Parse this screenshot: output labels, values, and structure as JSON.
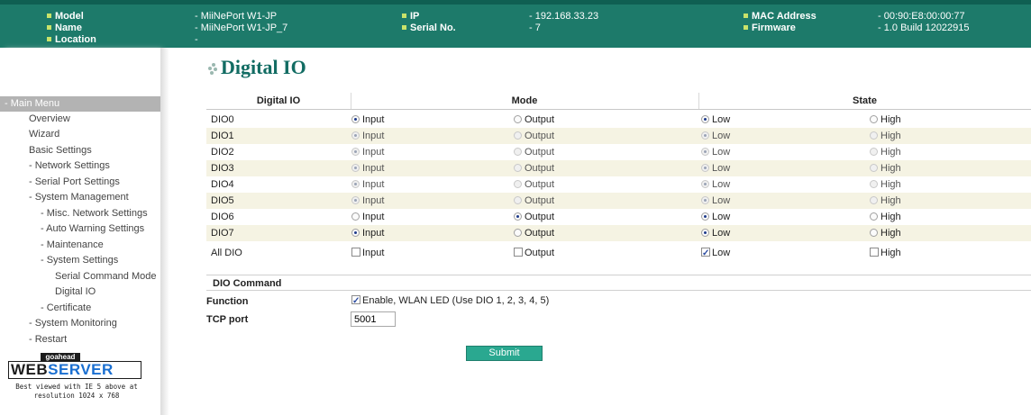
{
  "header": {
    "model_label": "Model",
    "model_value": "- MiiNePort W1-JP",
    "name_label": "Name",
    "name_value": "- MiiNePort W1-JP_7",
    "location_label": "Location",
    "location_value": "-",
    "ip_label": "IP",
    "ip_value": "- 192.168.33.23",
    "serial_label": "Serial No.",
    "serial_value": "- 7",
    "mac_label": "MAC Address",
    "mac_value": "- 00:90:E8:00:00:77",
    "firmware_label": "Firmware",
    "firmware_value": "- 1.0 Build 12022915"
  },
  "sidebar": {
    "menu_head": "- Main Menu",
    "items": [
      "Overview",
      "Wizard",
      "Basic Settings",
      "- Network Settings",
      "- Serial Port Settings",
      "- System Management",
      "- Misc. Network Settings",
      "- Auto Warning Settings",
      "- Maintenance",
      "- System Settings",
      "Serial Command Mode",
      "Digital IO",
      "- Certificate",
      "- System Monitoring",
      "- Restart"
    ],
    "logo_top": "goahead",
    "logo_web": "WEB",
    "logo_server": "SERVER",
    "logo_note_1": "Best viewed with IE 5 above at",
    "logo_note_2": "resolution 1024 x 768"
  },
  "page": {
    "title": "Digital IO",
    "col_dio": "Digital IO",
    "col_mode": "Mode",
    "col_state": "State",
    "input_label": "Input",
    "output_label": "Output",
    "low_label": "Low",
    "high_label": "High"
  },
  "rows": [
    {
      "name": "DIO0",
      "mode": "input",
      "state": "low",
      "enabled": true
    },
    {
      "name": "DIO1",
      "mode": "input",
      "state": "low",
      "enabled": false
    },
    {
      "name": "DIO2",
      "mode": "input",
      "state": "low",
      "enabled": false
    },
    {
      "name": "DIO3",
      "mode": "input",
      "state": "low",
      "enabled": false
    },
    {
      "name": "DIO4",
      "mode": "input",
      "state": "low",
      "enabled": false
    },
    {
      "name": "DIO5",
      "mode": "input",
      "state": "low",
      "enabled": false
    },
    {
      "name": "DIO6",
      "mode": "output",
      "state": "low",
      "enabled": true
    },
    {
      "name": "DIO7",
      "mode": "input",
      "state": "low",
      "enabled": true
    }
  ],
  "all_dio": {
    "name": "All DIO",
    "input_checked": false,
    "output_checked": false,
    "low_checked": true,
    "high_checked": false
  },
  "command": {
    "heading": "DIO Command",
    "function_label": "Function",
    "function_text": "Enable, WLAN LED (Use DIO 1, 2, 3, 4, 5)",
    "function_checked": true,
    "tcp_label": "TCP port",
    "tcp_value": "5001",
    "submit_label": "Submit"
  }
}
